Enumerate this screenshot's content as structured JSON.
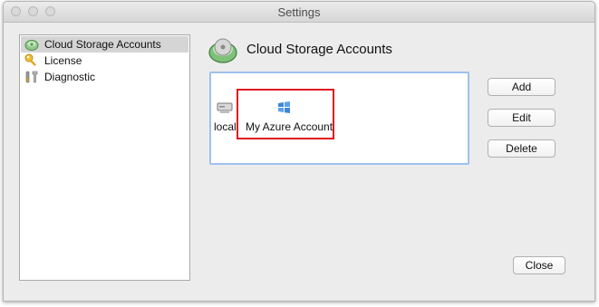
{
  "window": {
    "title": "Settings"
  },
  "sidebar": {
    "items": [
      {
        "label": "Cloud Storage Accounts",
        "icon": "cloud-storage-icon",
        "selected": true
      },
      {
        "label": "License",
        "icon": "key-icon",
        "selected": false
      },
      {
        "label": "Diagnostic",
        "icon": "tools-icon",
        "selected": false
      }
    ]
  },
  "main": {
    "title": "Cloud Storage Accounts",
    "accounts": [
      {
        "label": "local",
        "icon": "local-drive-icon"
      },
      {
        "label": "My Azure Account",
        "icon": "azure-icon"
      }
    ]
  },
  "buttons": {
    "add": "Add",
    "edit": "Edit",
    "delete": "Delete",
    "close": "Close"
  }
}
